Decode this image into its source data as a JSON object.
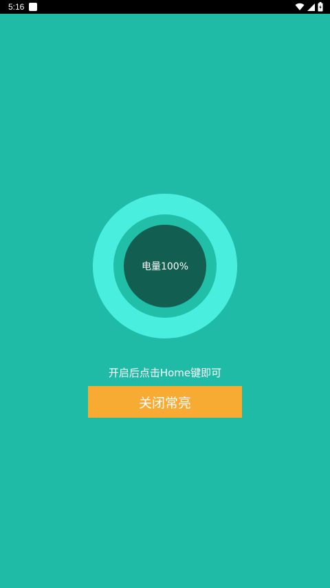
{
  "status_bar": {
    "time": "5:16",
    "icons": [
      "notification-icon",
      "wifi-icon",
      "cellular-icon",
      "battery-icon"
    ]
  },
  "gauge": {
    "label": "电量100%",
    "level_percent": 100
  },
  "hint": "开启后点击Home键即可",
  "close_button_label": "关闭常亮",
  "colors": {
    "background": "#1fbba6",
    "gauge_outer": "#4aeedf",
    "gauge_inner": "#125f52",
    "button": "#f7ab33"
  }
}
